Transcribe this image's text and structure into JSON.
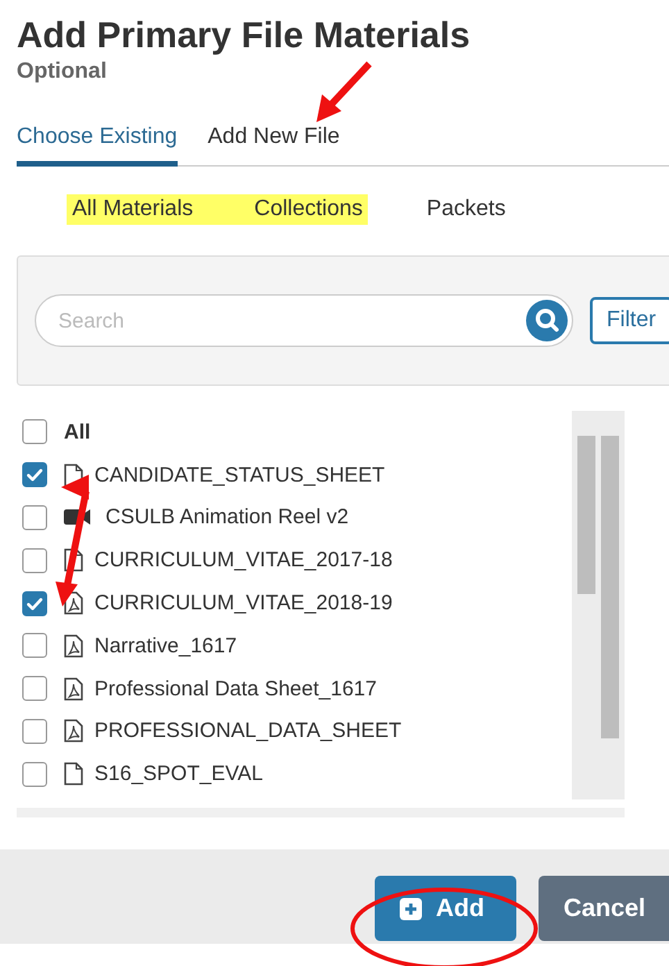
{
  "dialog": {
    "title": "Add Primary File Materials",
    "subtitle": "Optional"
  },
  "tabs": [
    {
      "label": "Choose Existing",
      "selected": true
    },
    {
      "label": "Add New File",
      "selected": false
    }
  ],
  "subtabs": [
    {
      "label": "All Materials",
      "highlighted": true
    },
    {
      "label": "Collections",
      "highlighted": true
    },
    {
      "label": "Packets",
      "highlighted": false
    }
  ],
  "search": {
    "placeholder": "Search"
  },
  "filter_button": "Filter",
  "select_all": {
    "label": "All",
    "checked": false
  },
  "files": [
    {
      "name": "CANDIDATE_STATUS_SHEET",
      "kind": "file",
      "checked": true
    },
    {
      "name": "CSULB Animation Reel v2",
      "kind": "video",
      "checked": false
    },
    {
      "name": "CURRICULUM_VITAE_2017-18",
      "kind": "file",
      "checked": false
    },
    {
      "name": "CURRICULUM_VITAE_2018-19",
      "kind": "pdf",
      "checked": true
    },
    {
      "name": "Narrative_1617",
      "kind": "pdf",
      "checked": false
    },
    {
      "name": "Professional Data Sheet_1617",
      "kind": "pdf",
      "checked": false
    },
    {
      "name": "PROFESSIONAL_DATA_SHEET",
      "kind": "pdf",
      "checked": false
    },
    {
      "name": "S16_SPOT_EVAL",
      "kind": "file",
      "checked": false
    }
  ],
  "buttons": [
    {
      "label": "Add",
      "kind": "primary"
    },
    {
      "label": "Cancel",
      "kind": "secondary"
    }
  ]
}
